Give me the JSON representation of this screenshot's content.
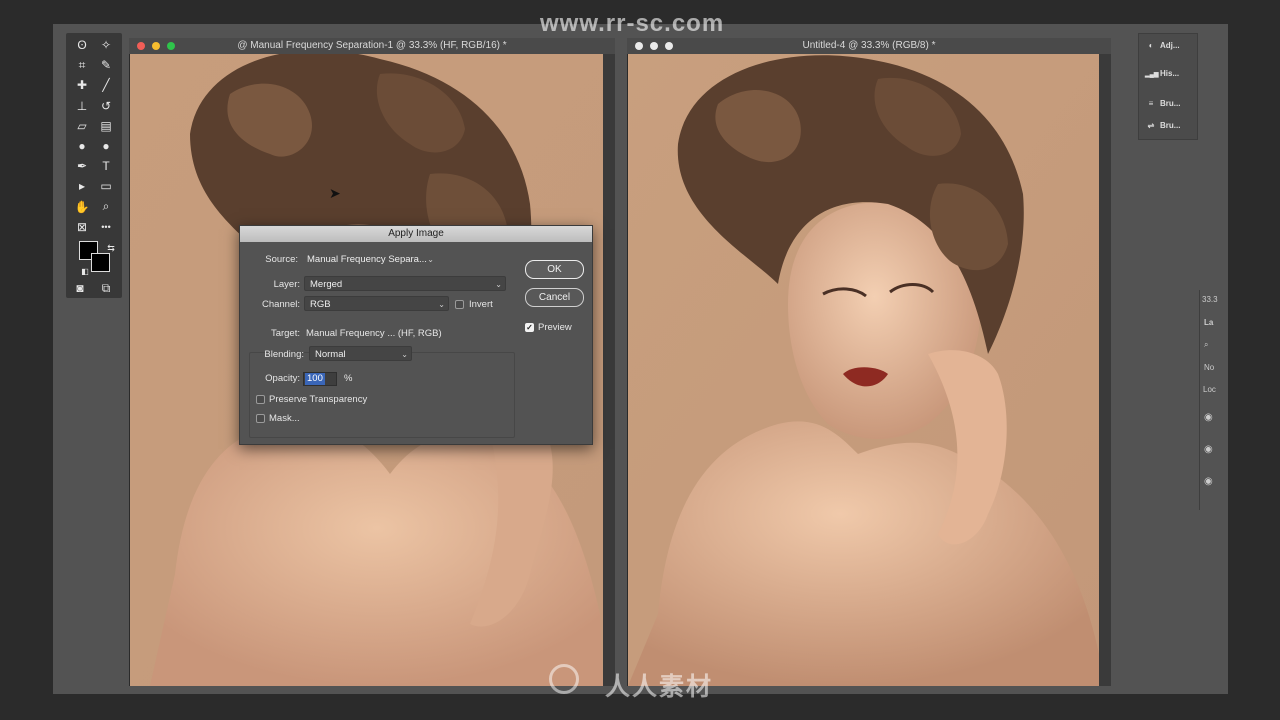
{
  "watermark": {
    "url": "www.rr-sc.com",
    "brand": "人人素材"
  },
  "tools": {
    "items": [
      "lasso",
      "magic-wand",
      "crop",
      "eyedropper",
      "healing-brush",
      "brush",
      "clone-stamp",
      "history-brush",
      "eraser",
      "gradient",
      "blur",
      "dodge",
      "pen",
      "type",
      "path-selection",
      "rectangle",
      "hand",
      "zoom",
      "frame",
      "more"
    ],
    "glyphs": [
      "ʘ",
      "✧",
      "⌗",
      "✎",
      "✚",
      "╱",
      "⊥",
      "↺",
      "▱",
      "▤",
      "●",
      "●",
      "✒",
      "T",
      "▸",
      "▭",
      "✋",
      "⌕",
      "⊠",
      "•••"
    ]
  },
  "documents": [
    {
      "title": "@ Manual Frequency Separation-1 @ 33.3% (HF, RGB/16) *"
    },
    {
      "title": "Untitled-4 @ 33.3% (RGB/8) *"
    }
  ],
  "right_panel": {
    "items": [
      {
        "label": "Adj...",
        "icon": "adjustments-icon",
        "glyph": "◐"
      },
      {
        "label": "His...",
        "icon": "histogram-icon",
        "glyph": "▂▄▆"
      },
      {
        "label": "Bru...",
        "icon": "brush-icon",
        "glyph": "≡"
      },
      {
        "label": "Bru...",
        "icon": "brush-settings-icon",
        "glyph": "⇌"
      }
    ]
  },
  "layers_panel": {
    "zoom": "33.3",
    "tab": "La",
    "mode": "No",
    "lock": "Loc"
  },
  "dialog": {
    "title": "Apply Image",
    "source_label": "Source:",
    "source_value": "Manual Frequency Separa...",
    "layer_label": "Layer:",
    "layer_value": "Merged",
    "channel_label": "Channel:",
    "channel_value": "RGB",
    "invert_label": "Invert",
    "invert_checked": false,
    "target_label": "Target:",
    "target_value": "Manual Frequency ... (HF, RGB)",
    "blending_label": "Blending:",
    "blending_value": "Normal",
    "opacity_label": "Opacity:",
    "opacity_value": "100",
    "opacity_unit": "%",
    "preserve_transparency_label": "Preserve Transparency",
    "preserve_transparency_checked": false,
    "mask_label": "Mask...",
    "mask_checked": false,
    "ok_label": "OK",
    "cancel_label": "Cancel",
    "preview_label": "Preview",
    "preview_checked": true
  },
  "colors": {
    "background": "#2b2b2b",
    "workspace": "#535353",
    "dialog_bg": "#535353",
    "accent": "#3a66b8"
  }
}
